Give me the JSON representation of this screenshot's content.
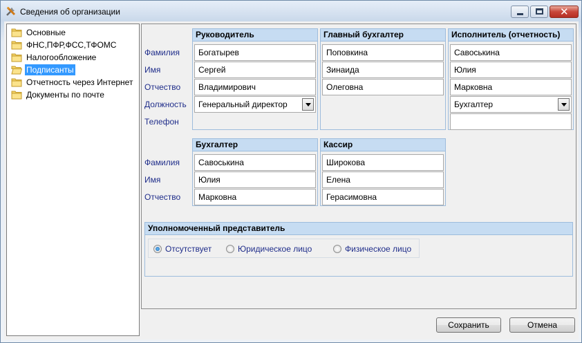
{
  "window": {
    "title": "Сведения об организации"
  },
  "tree": {
    "items": [
      {
        "label": "Основные",
        "selected": false
      },
      {
        "label": "ФНС,ПФР,ФСС,ТФОМС",
        "selected": false
      },
      {
        "label": "Налогообложение",
        "selected": false
      },
      {
        "label": "Подписанты",
        "selected": true
      },
      {
        "label": "Отчетность через Интернет",
        "selected": false
      },
      {
        "label": "Документы по почте",
        "selected": false
      }
    ]
  },
  "labels": {
    "top": {
      "last_name": "Фамилия",
      "first_name": "Имя",
      "patronymic": "Отчество",
      "position": "Должность",
      "phone": "Телефон"
    },
    "bottom": {
      "last_name": "Фамилия",
      "first_name": "Имя",
      "patronymic": "Отчество"
    }
  },
  "head": {
    "title": "Руководитель",
    "last_name": "Богатырев",
    "first_name": "Сергей",
    "patronymic": "Владимирович",
    "position": "Генеральный директор"
  },
  "chief_accountant": {
    "title": "Главный бухгалтер",
    "last_name": "Поповкина",
    "first_name": "Зинаида",
    "patronymic": "Олеговна"
  },
  "executor": {
    "title": "Исполнитель (отчетность)",
    "last_name": "Савоськина",
    "first_name": "Юлия",
    "patronymic": "Марковна",
    "position": "Бухгалтер",
    "phone": ""
  },
  "accountant": {
    "title": "Бухгалтер",
    "last_name": "Савоськина",
    "first_name": "Юлия",
    "patronymic": "Марковна"
  },
  "cashier": {
    "title": "Кассир",
    "last_name": "Широкова",
    "first_name": "Елена",
    "patronymic": "Герасимовна"
  },
  "representative": {
    "title": "Уполномоченный представитель",
    "options": [
      {
        "label": "Отсутствует",
        "checked": true
      },
      {
        "label": "Юридическое лицо",
        "checked": false
      },
      {
        "label": "Физическое лицо",
        "checked": false
      }
    ]
  },
  "buttons": {
    "save": "Сохранить",
    "cancel": "Отмена"
  },
  "colors": {
    "selection": "#3399ff",
    "group_header": "#c6dcf2",
    "row_label": "#1f2d8a",
    "close_button": "#c8463a"
  }
}
